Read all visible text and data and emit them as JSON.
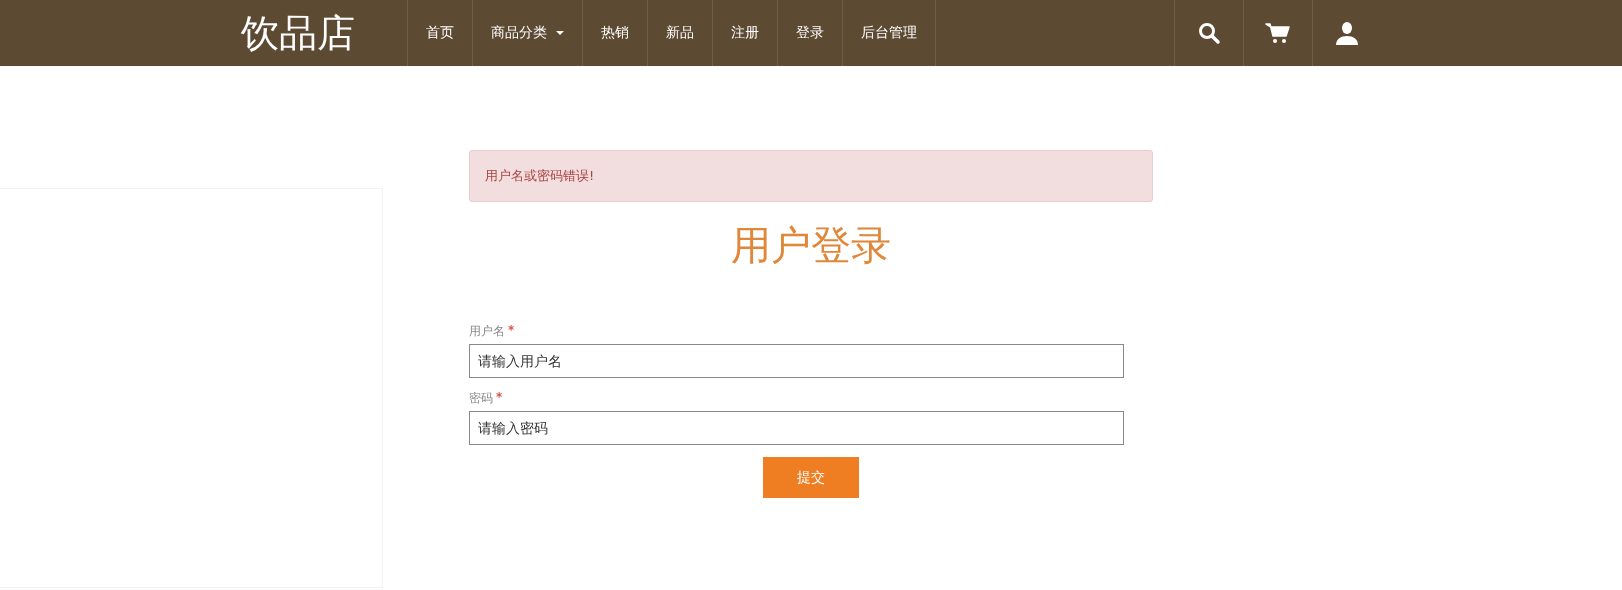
{
  "navbar": {
    "brand": "饮品店",
    "items": [
      {
        "label": "首页",
        "kind": "link"
      },
      {
        "label": "商品分类",
        "kind": "dropdown"
      },
      {
        "label": "热销",
        "kind": "link"
      },
      {
        "label": "新品",
        "kind": "link"
      },
      {
        "label": "注册",
        "kind": "link"
      },
      {
        "label": "登录",
        "kind": "link"
      },
      {
        "label": "后台管理",
        "kind": "link"
      }
    ],
    "icons": [
      {
        "kind": "search"
      },
      {
        "kind": "cart"
      },
      {
        "kind": "user"
      }
    ]
  },
  "alert": {
    "text": "用户名或密码错误!"
  },
  "title": "用户登录",
  "fields": [
    {
      "label": "用户名",
      "required": true,
      "required_mark": "*",
      "placeholder": "请输入用户名"
    },
    {
      "label": "密码",
      "required": true,
      "required_mark": "*",
      "placeholder": "请输入密码"
    }
  ],
  "submit": "提交"
}
